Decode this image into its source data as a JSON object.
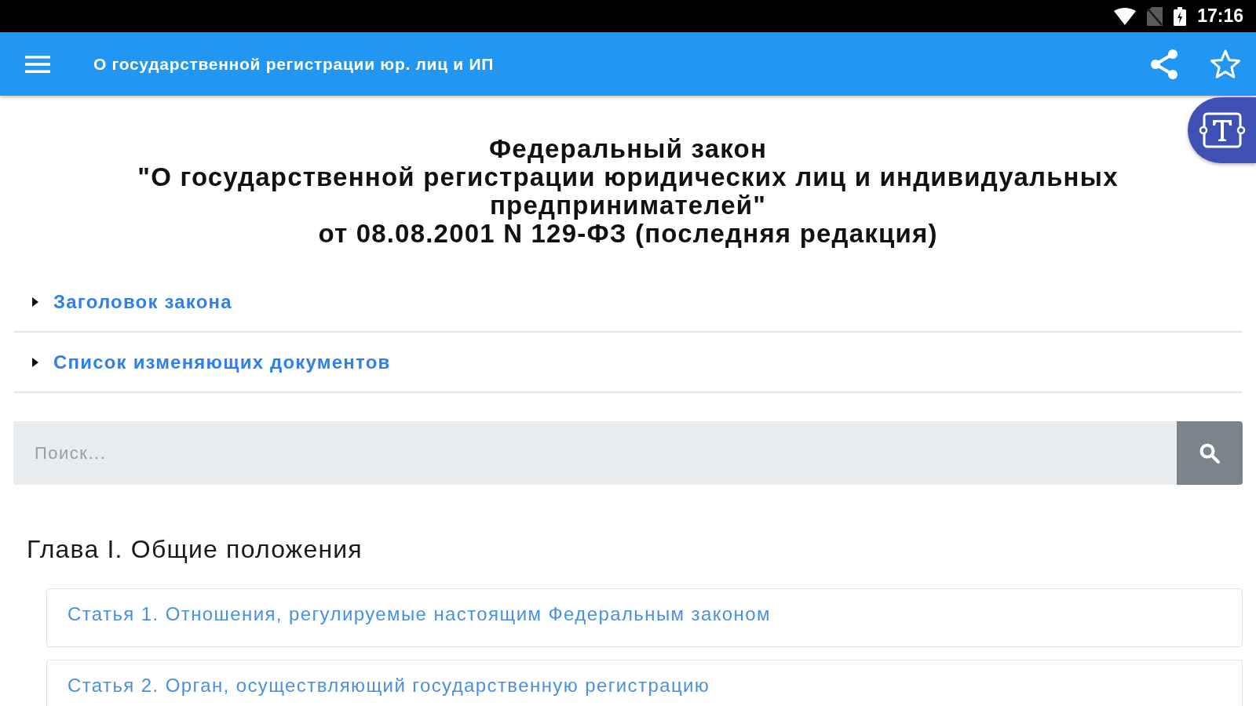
{
  "status_bar": {
    "time": "17:16"
  },
  "app_bar": {
    "title": "О государственной регистрации юр. лиц и ИП"
  },
  "document": {
    "title_lines": [
      "Федеральный закон",
      "\"О государственной регистрации юридических лиц и индивидуальных предпринимателей\"",
      "от 08.08.2001 N 129-ФЗ (последняя редакция)"
    ]
  },
  "sections": [
    {
      "label": "Заголовок закона",
      "expanded": false
    },
    {
      "label": "Список изменяющих документов",
      "expanded": false
    }
  ],
  "search": {
    "placeholder": "Поиск..."
  },
  "chapters": [
    {
      "title": "Глава I. Общие положения",
      "articles": [
        "Статья 1. Отношения, регулируемые настоящим Федеральным законом",
        "Статья 2. Орган, осуществляющий государственную регистрацию"
      ]
    }
  ]
}
